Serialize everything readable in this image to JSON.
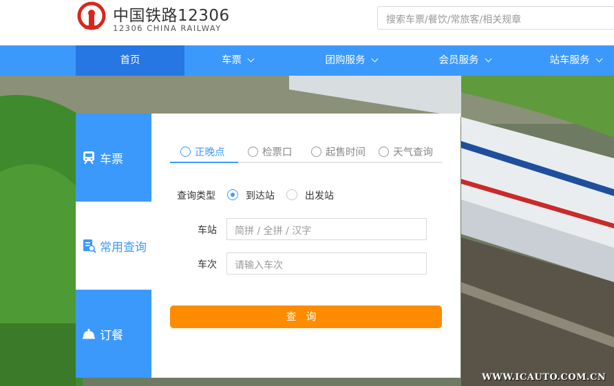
{
  "header": {
    "brand_title": "中国铁路12306",
    "brand_sub": "12306 CHINA RAILWAY",
    "logo_icon": "railway-logo-icon",
    "search_placeholder": "搜索车票/餐饮/常旅客/相关规章"
  },
  "nav": {
    "items": [
      {
        "label": "首页",
        "active": true
      },
      {
        "label": "车票",
        "dropdown": true
      },
      {
        "label": "团购服务",
        "dropdown": true
      },
      {
        "label": "会员服务",
        "dropdown": true
      },
      {
        "label": "站车服务",
        "dropdown": true
      }
    ]
  },
  "side": {
    "tabs": [
      {
        "label": "车票",
        "icon": "train-icon"
      },
      {
        "label": "常用查询",
        "icon": "query-icon",
        "active": true
      },
      {
        "label": "订餐",
        "icon": "meal-bell-icon"
      }
    ]
  },
  "panel": {
    "tabs": [
      {
        "label": "正晚点",
        "icon": "clock-icon",
        "active": true
      },
      {
        "label": "检票口",
        "icon": "gate-icon"
      },
      {
        "label": "起售时间",
        "icon": "timer-icon"
      },
      {
        "label": "天气查询",
        "icon": "weather-icon"
      }
    ],
    "query_type_label": "查询类型",
    "radio_arrive": "到达站",
    "radio_depart": "出发站",
    "selected_radio": "到达站",
    "station_label": "车站",
    "station_placeholder": "简拼 / 全拼 / 汉字",
    "train_label": "车次",
    "train_placeholder": "请输入车次",
    "search_button": "查询"
  },
  "watermark": "WWW.ICAUTO.COM.CN",
  "colors": {
    "primary": "#3b99fc",
    "nav_active": "#2676e3",
    "button": "#ff8c00",
    "logo_red": "#d9261c"
  }
}
